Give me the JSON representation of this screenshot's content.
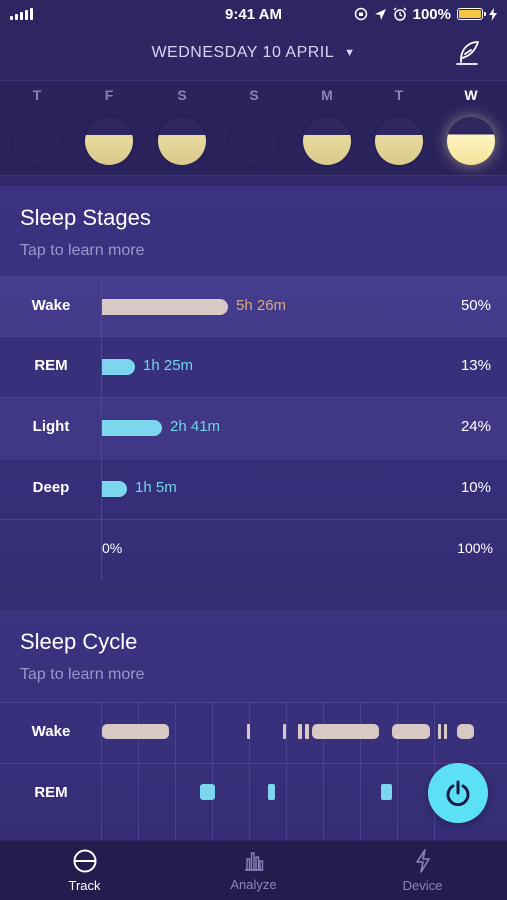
{
  "status": {
    "time": "9:41 AM",
    "battery": "100%"
  },
  "header": {
    "date": "WEDNESDAY 10 APRIL",
    "caret": "▼"
  },
  "week": [
    {
      "letter": "T",
      "state": "empty"
    },
    {
      "letter": "F",
      "state": "normal"
    },
    {
      "letter": "S",
      "state": "normal"
    },
    {
      "letter": "S",
      "state": "empty"
    },
    {
      "letter": "M",
      "state": "normal"
    },
    {
      "letter": "T",
      "state": "normal"
    },
    {
      "letter": "W",
      "state": "active"
    }
  ],
  "stages": {
    "title": "Sleep Stages",
    "subtitle": "Tap to learn more",
    "rows": [
      {
        "label": "Wake",
        "duration": "5h 26m",
        "percent": "50%",
        "fraction": 0.5,
        "color": "#d9c9c4",
        "text_color": "#d8a87e"
      },
      {
        "label": "REM",
        "duration": "1h 25m",
        "percent": "13%",
        "fraction": 0.13,
        "color": "#7cd6ee",
        "text_color": "#6fd4ee"
      },
      {
        "label": "Light",
        "duration": "2h 41m",
        "percent": "24%",
        "fraction": 0.24,
        "color": "#7cd6ee",
        "text_color": "#6fd4ee"
      },
      {
        "label": "Deep",
        "duration": "1h 5m",
        "percent": "10%",
        "fraction": 0.1,
        "color": "#7cd6ee",
        "text_color": "#6fd4ee"
      }
    ],
    "axis_min": "0%",
    "axis_max": "100%"
  },
  "cycle": {
    "title": "Sleep Cycle",
    "subtitle": "Tap to learn more",
    "rows": [
      {
        "label": "Wake"
      },
      {
        "label": "REM"
      }
    ]
  },
  "tabs": [
    {
      "label": "Track",
      "icon": "track-icon",
      "active": true
    },
    {
      "label": "Analyze",
      "icon": "analyze-icon",
      "active": false
    },
    {
      "label": "Device",
      "icon": "device-icon",
      "active": false
    }
  ],
  "colors": {
    "accent": "#5ce0f5",
    "wake": "#d9c9c4",
    "rem": "#7cd6ee",
    "background": "#2d2662"
  }
}
